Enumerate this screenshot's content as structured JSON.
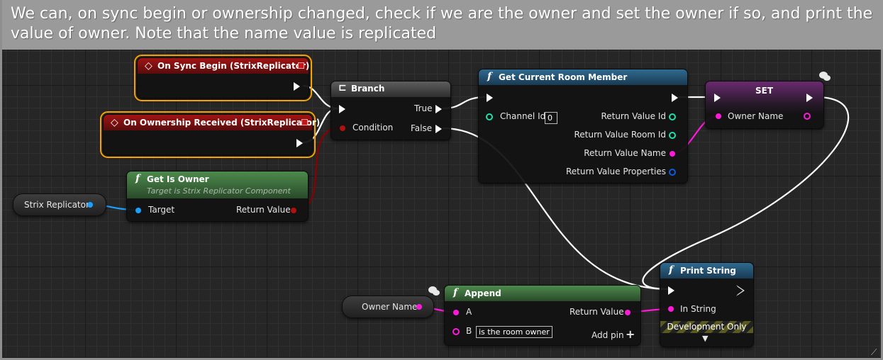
{
  "comment": "We can, on sync begin or ownership changed, check if we are the owner and set the owner if so, and print the value of owner. Note that the name value is replicated",
  "nodes": {
    "sync_begin": {
      "title": "On Sync Begin (StrixReplicator)"
    },
    "ownership": {
      "title": "On Ownership Received (StrixReplicator)"
    },
    "get_is_owner": {
      "title": "Get Is Owner",
      "subtitle": "Target is Strix Replicator Component",
      "target": "Target",
      "return": "Return Value"
    },
    "strix_replicator": {
      "label": "Strix Replicator"
    },
    "branch": {
      "title": "Branch",
      "condition": "Condition",
      "true": "True",
      "false": "False"
    },
    "room_member": {
      "title": "Get Current Room Member",
      "channel_id": "Channel Id",
      "channel_value": "0",
      "outputs": [
        "Return Value Id",
        "Return Value Room Id",
        "Return Value Name",
        "Return Value Properties"
      ]
    },
    "set": {
      "title": "SET",
      "pin": "Owner Name"
    },
    "owner_name_var": {
      "label": "Owner Name"
    },
    "append": {
      "title": "Append",
      "a": "A",
      "b": "B",
      "b_value": "is the room owner",
      "return": "Return Value",
      "add_pin": "Add pin"
    },
    "print": {
      "title": "Print String",
      "in_string": "In String",
      "dev": "Development Only"
    }
  },
  "colors": {
    "exec": "#ffffff",
    "bool": "#8b0000",
    "string": "#ff1ad9",
    "object": "#1aa0ff",
    "int": "#1fe0a8",
    "struct": "#0a5ce0",
    "event_header": "#8a1010",
    "pure_header": "#3a6a3a",
    "func_header": "#25506e",
    "var_header": "#8c2690",
    "selection": "#f5a300"
  }
}
